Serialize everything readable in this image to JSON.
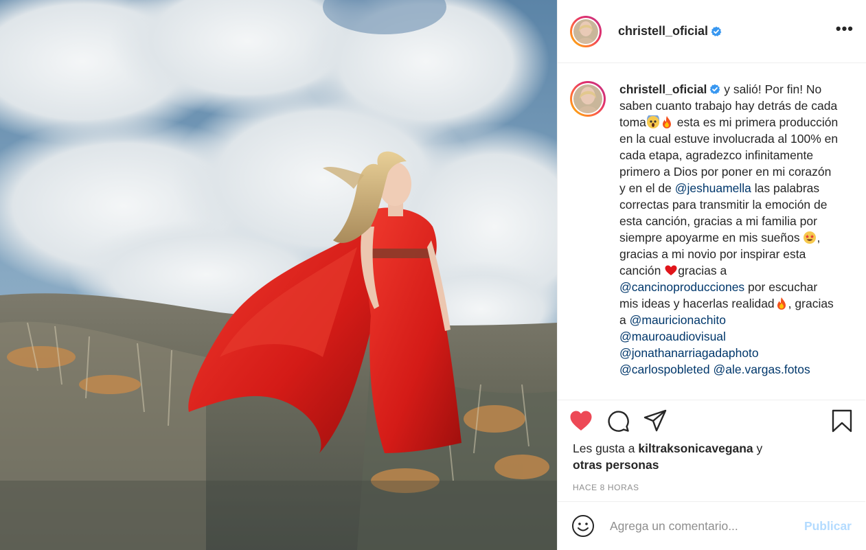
{
  "post": {
    "username": "christell_oficial",
    "more_label": "•••",
    "caption": {
      "username": "christell_oficial",
      "t1": " y salió! Por fin! No saben cuanto trabajo hay detrás de cada toma",
      "t2": " esta es mi primera producción en la cual estuve involucrada al 100% en cada etapa, agradezco infinitamente primero a Dios por poner en mi corazón y en el de ",
      "m1": "@jeshuamella",
      "t3": " las palabras correctas para transmitir la emoción de esta canción, gracias a mi familia por siempre apoyarme en mis sueños ",
      "t4": ", gracias a mi novio por inspirar esta canción ",
      "t5": "gracias a ",
      "m2": "@cancinoproducciones",
      "t6": " por escuchar mis ideas y hacerlas realidad",
      "t7": ", gracias a ",
      "m3": "@mauricionachito",
      "m4": "@mauroaudiovisual",
      "m5": "@jonathanarriagadaphoto",
      "m6": "@carlospobleted",
      "m7": "@ale.vargas.fotos"
    },
    "likes": {
      "prefix": "Les gusta a ",
      "user": "kiltraksonicavegana",
      "mid": " y",
      "others": "otras personas"
    },
    "time": "HACE 8 HORAS",
    "comment": {
      "placeholder": "Agrega un comentario...",
      "publish": "Publicar"
    },
    "icons": [
      "heart-icon",
      "comment-icon",
      "share-icon",
      "bookmark-icon",
      "emoji-icon",
      "verified-icon",
      "more-icon"
    ],
    "colors": {
      "like": "#ed4956",
      "verified": "#3897f0",
      "mention": "#00376b",
      "publish": "#b3dbff",
      "dress": "#d81f1f"
    }
  }
}
